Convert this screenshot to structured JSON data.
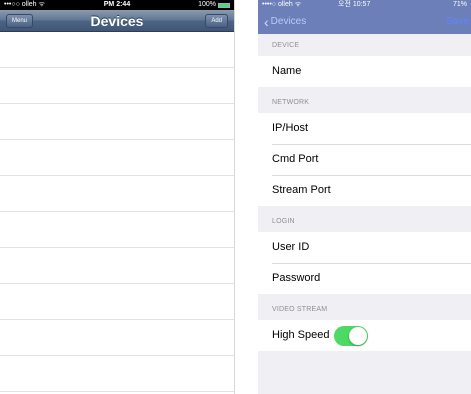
{
  "left_screen": {
    "status_bar": {
      "carrier": "•••○○ olleh ᯤ",
      "time": "PM 2:44",
      "battery": "100%"
    },
    "nav": {
      "title": "Devices",
      "left_button": "Menu",
      "right_button": "Add"
    }
  },
  "right_screen": {
    "status_bar": {
      "carrier": "••••○ olleh ᯤ",
      "time": "오전 10:57",
      "battery": "71%"
    },
    "nav": {
      "back_label": "Devices",
      "action_label": "Save"
    },
    "sections": {
      "device": {
        "header": "DEVICE",
        "name_label": "Name"
      },
      "network": {
        "header": "NETWORK",
        "ip_label": "IP/Host",
        "cmd_label": "Cmd Port",
        "stream_label": "Stream Port"
      },
      "login": {
        "header": "LOGIN",
        "user_label": "User ID",
        "password_label": "Password"
      },
      "video": {
        "header": "VIDEO STREAM",
        "high_speed_label": "High Speed",
        "high_speed_on": true
      }
    }
  },
  "colors": {
    "toggle_on": "#4cd964",
    "ios7_nav": "#6d7fb9",
    "ios6_nav": "#4e6484"
  }
}
